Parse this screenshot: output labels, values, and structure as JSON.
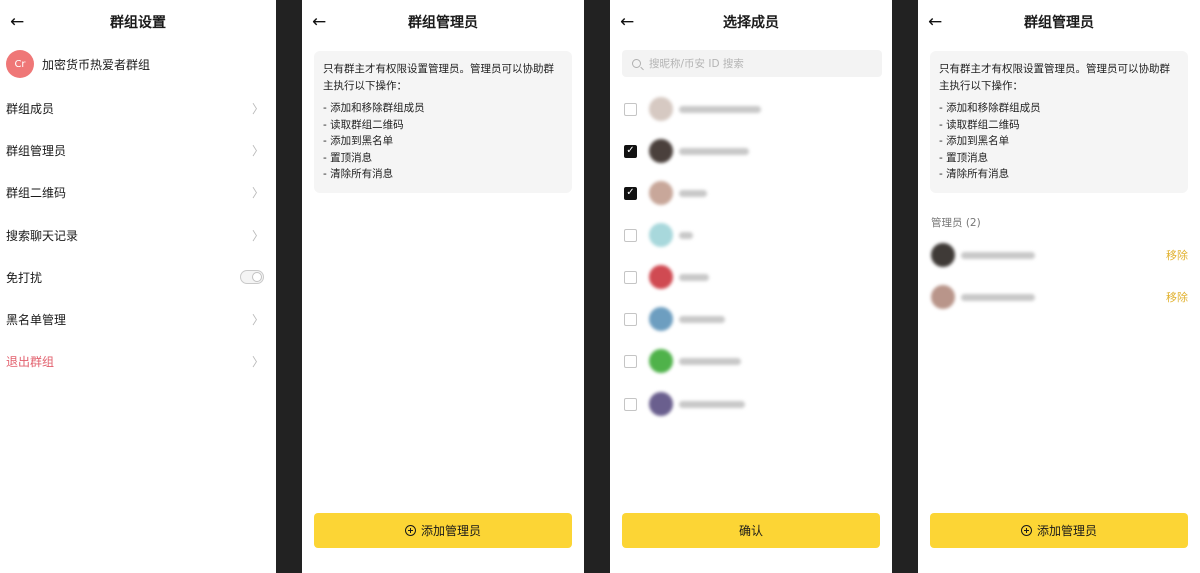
{
  "screen1": {
    "title": "群组设置",
    "group": {
      "avatar_text": "Cr",
      "name": "加密货币热爱者群组"
    },
    "items": [
      {
        "label": "群组成员"
      },
      {
        "label": "群组管理员"
      },
      {
        "label": "群组二维码"
      },
      {
        "label": "搜索聊天记录"
      },
      {
        "label": "免打扰",
        "toggle": false
      },
      {
        "label": "黑名单管理"
      },
      {
        "label": "退出群组",
        "color": "#e2606d"
      }
    ]
  },
  "screen2": {
    "title": "群组管理员",
    "info": {
      "intro": "只有群主才有权限设置管理员。管理员可以协助群主执行以下操作：",
      "items": [
        "- 添加和移除群组成员",
        "- 读取群组二维码",
        "- 添加到黑名单",
        "- 置顶消息",
        "- 清除所有消息"
      ]
    },
    "button": "添加管理员"
  },
  "screen3": {
    "title": "选择成员",
    "search_placeholder": "搜昵称/币安 ID 搜索",
    "members": [
      {
        "checked": false
      },
      {
        "checked": true
      },
      {
        "checked": true
      },
      {
        "checked": false
      },
      {
        "checked": false
      },
      {
        "checked": false
      },
      {
        "checked": false
      },
      {
        "checked": false
      }
    ],
    "button": "确认"
  },
  "screen4": {
    "title": "群组管理员",
    "info": {
      "intro": "只有群主才有权限设置管理员。管理员可以协助群主执行以下操作：",
      "items": [
        "- 添加和移除群组成员",
        "- 读取群组二维码",
        "- 添加到黑名单",
        "- 置顶消息",
        "- 清除所有消息"
      ]
    },
    "section_label": "管理员 (2)",
    "admins": [
      {
        "remove_label": "移除"
      },
      {
        "remove_label": "移除"
      }
    ],
    "button": "添加管理员"
  },
  "colors": {
    "accent": "#fcd535",
    "danger": "#e2606d",
    "remove": "#e1b12e"
  }
}
